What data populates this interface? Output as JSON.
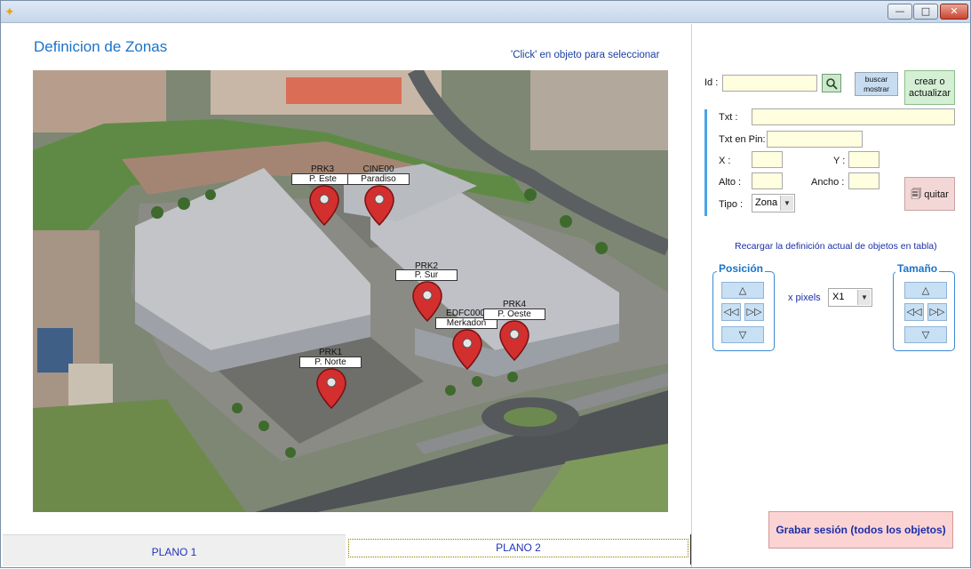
{
  "window": {
    "app_icon": "app-bird-icon",
    "minimize": "—",
    "maximize": "□",
    "close": "✕"
  },
  "page": {
    "title": "Definicion de Zonas",
    "hint": "'Click' en objeto para seleccionar"
  },
  "pins": [
    {
      "code": "PRK3",
      "label": "P. Este"
    },
    {
      "code": "CINE00",
      "label": "Paradiso"
    },
    {
      "code": "PRK2",
      "label": "P. Sur"
    },
    {
      "code": "EDFC000",
      "label": "Merkadon"
    },
    {
      "code": "PRK4",
      "label": "P. Oeste"
    },
    {
      "code": "PRK1",
      "label": "P. Norte"
    }
  ],
  "tabs": {
    "plano1": "PLANO 1",
    "plano2": "PLANO 2"
  },
  "form": {
    "id_label": "Id :",
    "buscar_label": "buscar mostrar",
    "buscar_line1": "buscar",
    "buscar_line2": "mostrar",
    "crear_line1": "crear o",
    "crear_line2": "actualizar",
    "txt_label": "Txt :",
    "txt_pin_label": "Txt en Pin:",
    "x_label": "X :",
    "y_label": "Y :",
    "alto_label": "Alto :",
    "ancho_label": "Ancho :",
    "tipo_label": "Tipo :",
    "tipo_value": "Zona",
    "quitar_label": "quitar"
  },
  "reload_text": "Recargar la definición actual de objetos en tabla)",
  "posicion": {
    "title": "Posición"
  },
  "tamano": {
    "title": "Tamaño"
  },
  "xpixels_label": "x pixels",
  "multiplier_value": "X1",
  "grabar_label": "Grabar sesión (todos los objetos)",
  "colors": {
    "accent": "#1a73c8",
    "pin": "#d32f2f",
    "field_bg": "#ffffe0"
  }
}
